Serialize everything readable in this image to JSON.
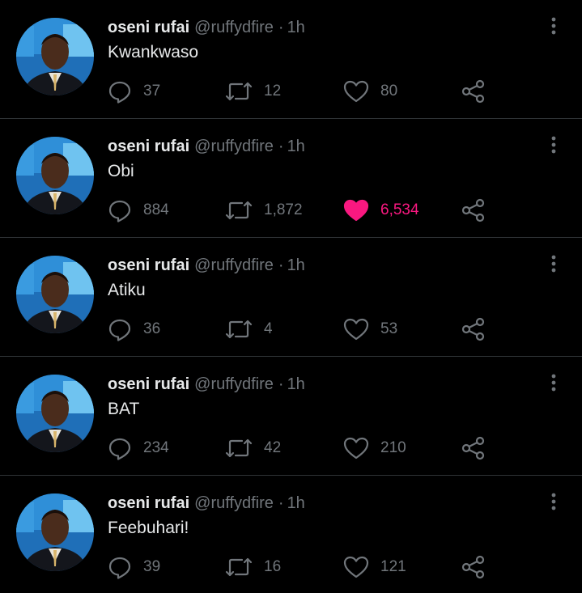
{
  "tweets": [
    {
      "name": "oseni rufai",
      "handle": "@ruffydfire",
      "separator": "·",
      "time": "1h",
      "text": "Kwankwaso",
      "replies": "37",
      "retweets": "12",
      "likes": "80",
      "liked": false
    },
    {
      "name": "oseni rufai",
      "handle": "@ruffydfire",
      "separator": "·",
      "time": "1h",
      "text": "Obi",
      "replies": "884",
      "retweets": "1,872",
      "likes": "6,534",
      "liked": true
    },
    {
      "name": "oseni rufai",
      "handle": "@ruffydfire",
      "separator": "·",
      "time": "1h",
      "text": "Atiku",
      "replies": "36",
      "retweets": "4",
      "likes": "53",
      "liked": false
    },
    {
      "name": "oseni rufai",
      "handle": "@ruffydfire",
      "separator": "·",
      "time": "1h",
      "text": "BAT",
      "replies": "234",
      "retweets": "42",
      "likes": "210",
      "liked": false
    },
    {
      "name": "oseni rufai",
      "handle": "@ruffydfire",
      "separator": "·",
      "time": "1h",
      "text": "Feebuhari!",
      "replies": "39",
      "retweets": "16",
      "likes": "121",
      "liked": false
    }
  ],
  "icons": {
    "reply": "reply-icon",
    "retweet": "retweet-icon",
    "like": "heart-icon",
    "share": "share-icon",
    "more": "more-options-icon"
  },
  "colors": {
    "background": "#000000",
    "text_primary": "#e7e9ea",
    "text_secondary": "#71767b",
    "like_active": "#f91880",
    "divider": "#2f3336"
  }
}
